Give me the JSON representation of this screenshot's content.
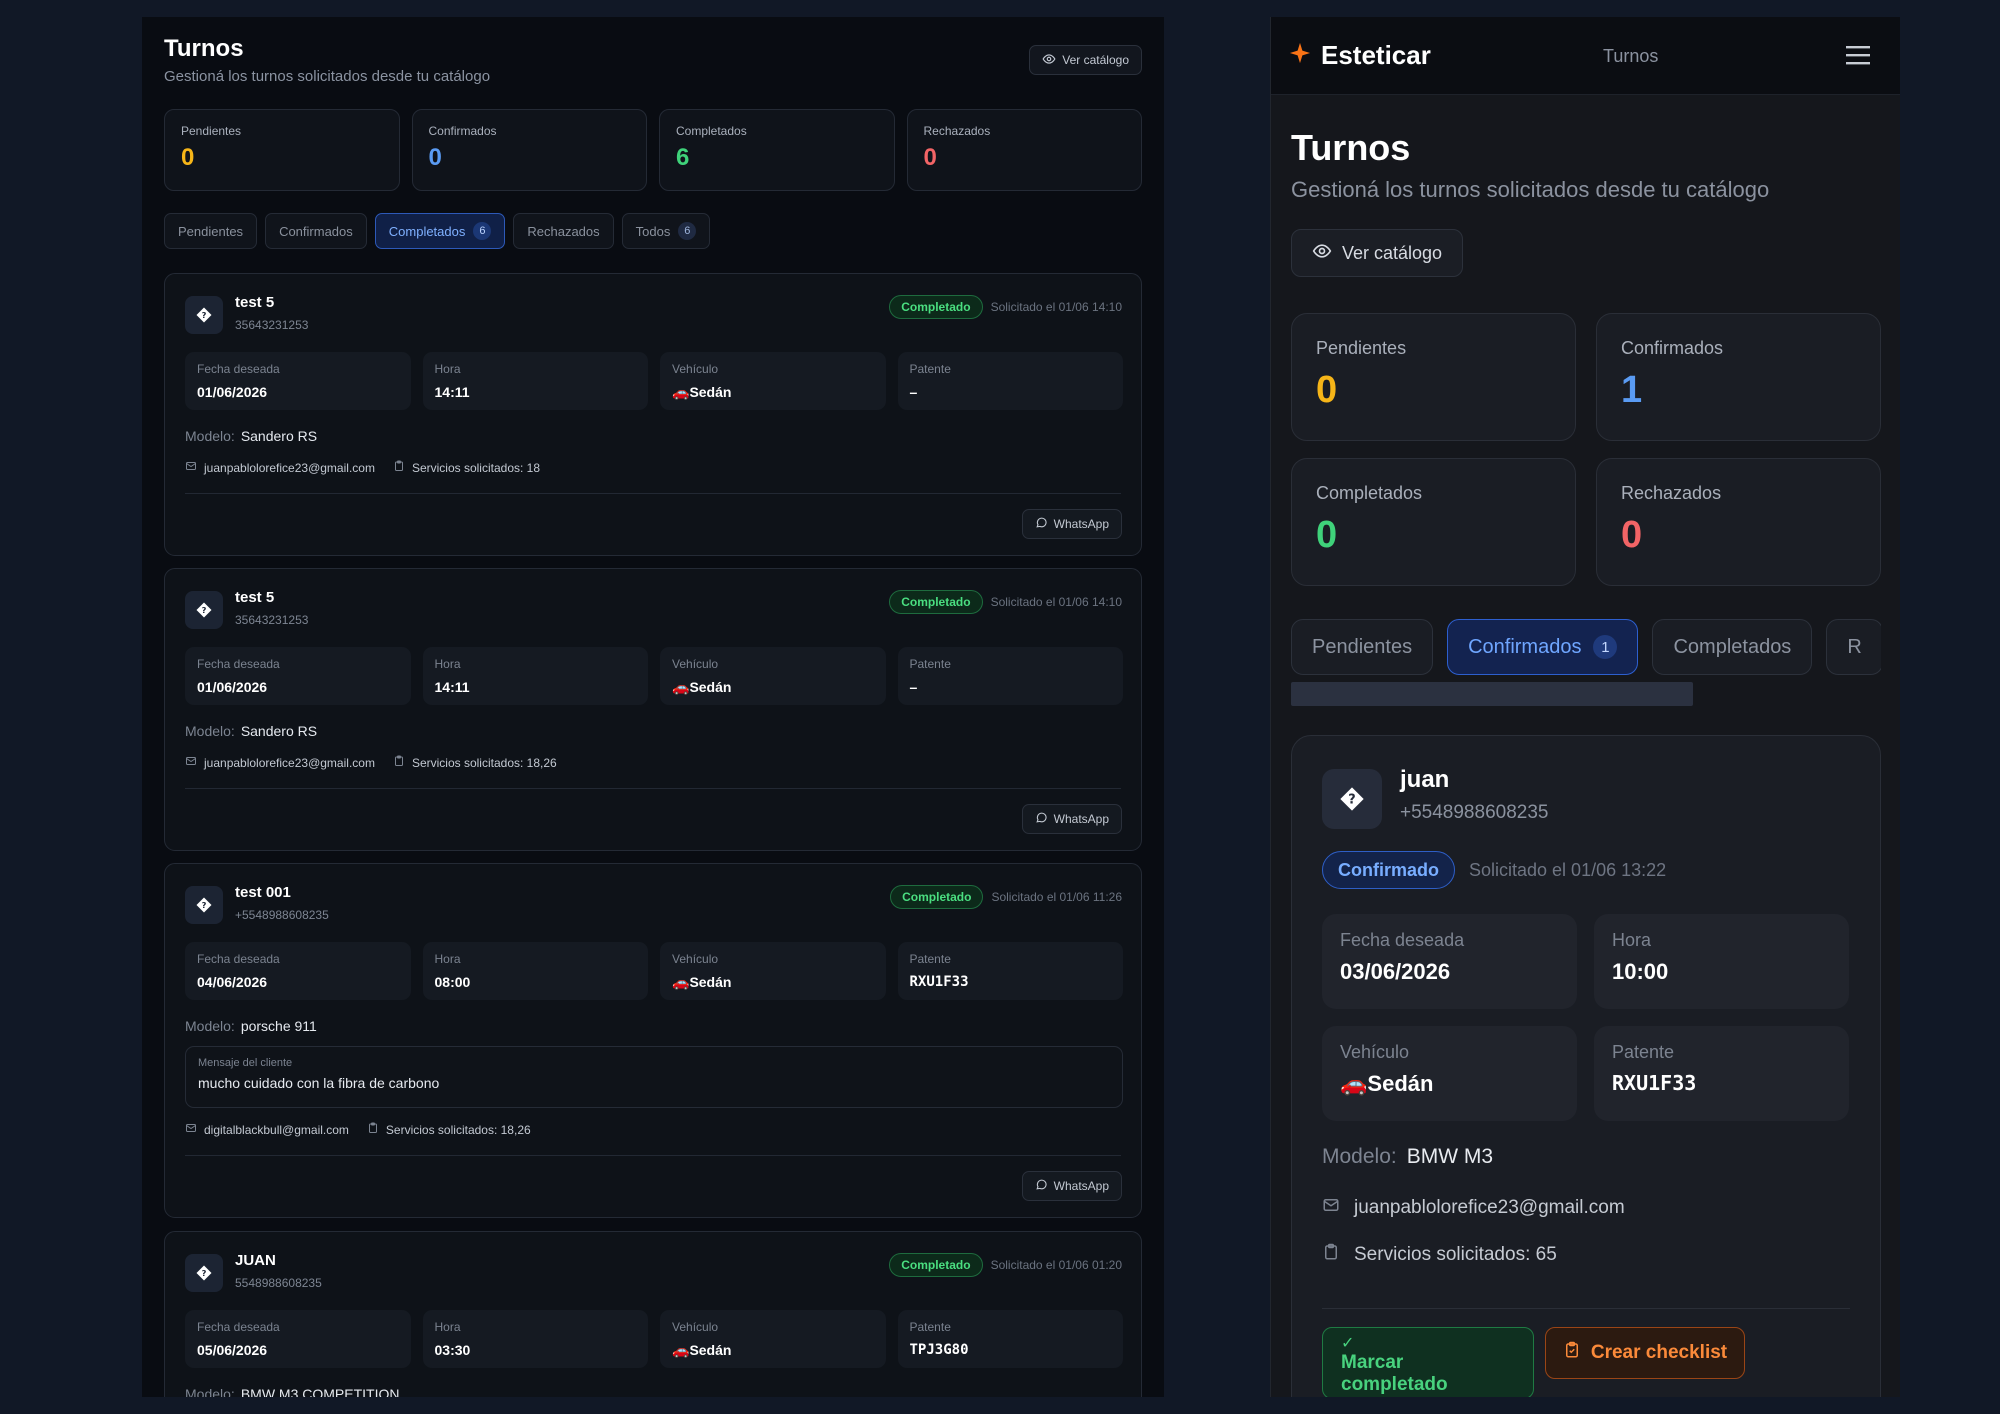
{
  "left": {
    "title": "Turnos",
    "subtitle": "Gestioná los turnos solicitados desde tu catálogo",
    "ver_catalogo": "Ver catálogo",
    "stats": [
      {
        "label": "Pendientes",
        "value": "0",
        "color": "#f6b518"
      },
      {
        "label": "Confirmados",
        "value": "0",
        "color": "#5a9bf3"
      },
      {
        "label": "Completados",
        "value": "6",
        "color": "#3fd27a"
      },
      {
        "label": "Rechazados",
        "value": "0",
        "color": "#f26466"
      }
    ],
    "tabs": [
      {
        "label": "Pendientes"
      },
      {
        "label": "Confirmados"
      },
      {
        "label": "Completados",
        "count": "6",
        "active": true
      },
      {
        "label": "Rechazados"
      },
      {
        "label": "Todos",
        "count": "6"
      }
    ],
    "field_labels": {
      "fecha": "Fecha deseada",
      "hora": "Hora",
      "vehiculo": "Vehículo",
      "patente": "Patente"
    },
    "model_label": "Modelo:",
    "message_label": "Mensaje del cliente",
    "whatsapp": "WhatsApp",
    "cards": [
      {
        "name": "test 5",
        "phone": "35643231253",
        "status": "Completado",
        "requested": "Solicitado el 01/06 14:10",
        "fecha": "01/06/2026",
        "hora": "14:11",
        "vehiculo": "Sedán",
        "patente": "–",
        "modelo": "Sandero RS",
        "email": "juanpablolorefice23@gmail.com",
        "servicios": "Servicios solicitados: 18"
      },
      {
        "name": "test 5",
        "phone": "35643231253",
        "status": "Completado",
        "requested": "Solicitado el 01/06 14:10",
        "fecha": "01/06/2026",
        "hora": "14:11",
        "vehiculo": "Sedán",
        "patente": "–",
        "modelo": "Sandero RS",
        "email": "juanpablolorefice23@gmail.com",
        "servicios": "Servicios solicitados: 18,26"
      },
      {
        "name": "test 001",
        "phone": "+5548988608235",
        "status": "Completado",
        "requested": "Solicitado el 01/06 11:26",
        "fecha": "04/06/2026",
        "hora": "08:00",
        "vehiculo": "Sedán",
        "patente": "RXU1F33",
        "modelo": "porsche 911",
        "mensaje": "mucho cuidado con la fibra de carbono",
        "email": "digitalblackbull@gmail.com",
        "servicios": "Servicios solicitados: 18,26"
      },
      {
        "name": "JUAN",
        "phone": "5548988608235",
        "status": "Completado",
        "requested": "Solicitado el 01/06 01:20",
        "fecha": "05/06/2026",
        "hora": "03:30",
        "vehiculo": "Sedán",
        "patente": "TPJ3G80",
        "modelo": "BMW M3 COMPETITION"
      }
    ]
  },
  "right": {
    "brand": "Esteticar",
    "nav_link": "Turnos",
    "title": "Turnos",
    "subtitle": "Gestioná los turnos solicitados desde tu catálogo",
    "ver_catalogo": "Ver catálogo",
    "stats": [
      {
        "label": "Pendientes",
        "value": "0",
        "color": "#f6b518"
      },
      {
        "label": "Confirmados",
        "value": "1",
        "color": "#5a9bf3"
      },
      {
        "label": "Completados",
        "value": "0",
        "color": "#3fd27a"
      },
      {
        "label": "Rechazados",
        "value": "0",
        "color": "#f26466"
      }
    ],
    "tabs": [
      {
        "label": "Pendientes"
      },
      {
        "label": "Confirmados",
        "count": "1",
        "active": true
      },
      {
        "label": "Completados"
      },
      {
        "label": "R"
      }
    ],
    "card": {
      "name": "juan",
      "phone": "+5548988608235",
      "status": "Confirmado",
      "requested": "Solicitado el 01/06 13:22",
      "fecha_label": "Fecha deseada",
      "fecha": "03/06/2026",
      "hora_label": "Hora",
      "hora": "10:00",
      "vehiculo_label": "Vehículo",
      "vehiculo": "Sedán",
      "patente_label": "Patente",
      "patente": "RXU1F33",
      "model_label": "Modelo:",
      "modelo": "BMW M3",
      "email": "juanpablolorefice23@gmail.com",
      "servicios": "Servicios solicitados: 65",
      "btn_done": "Marcar completado",
      "btn_checklist": "Crear checklist"
    }
  }
}
